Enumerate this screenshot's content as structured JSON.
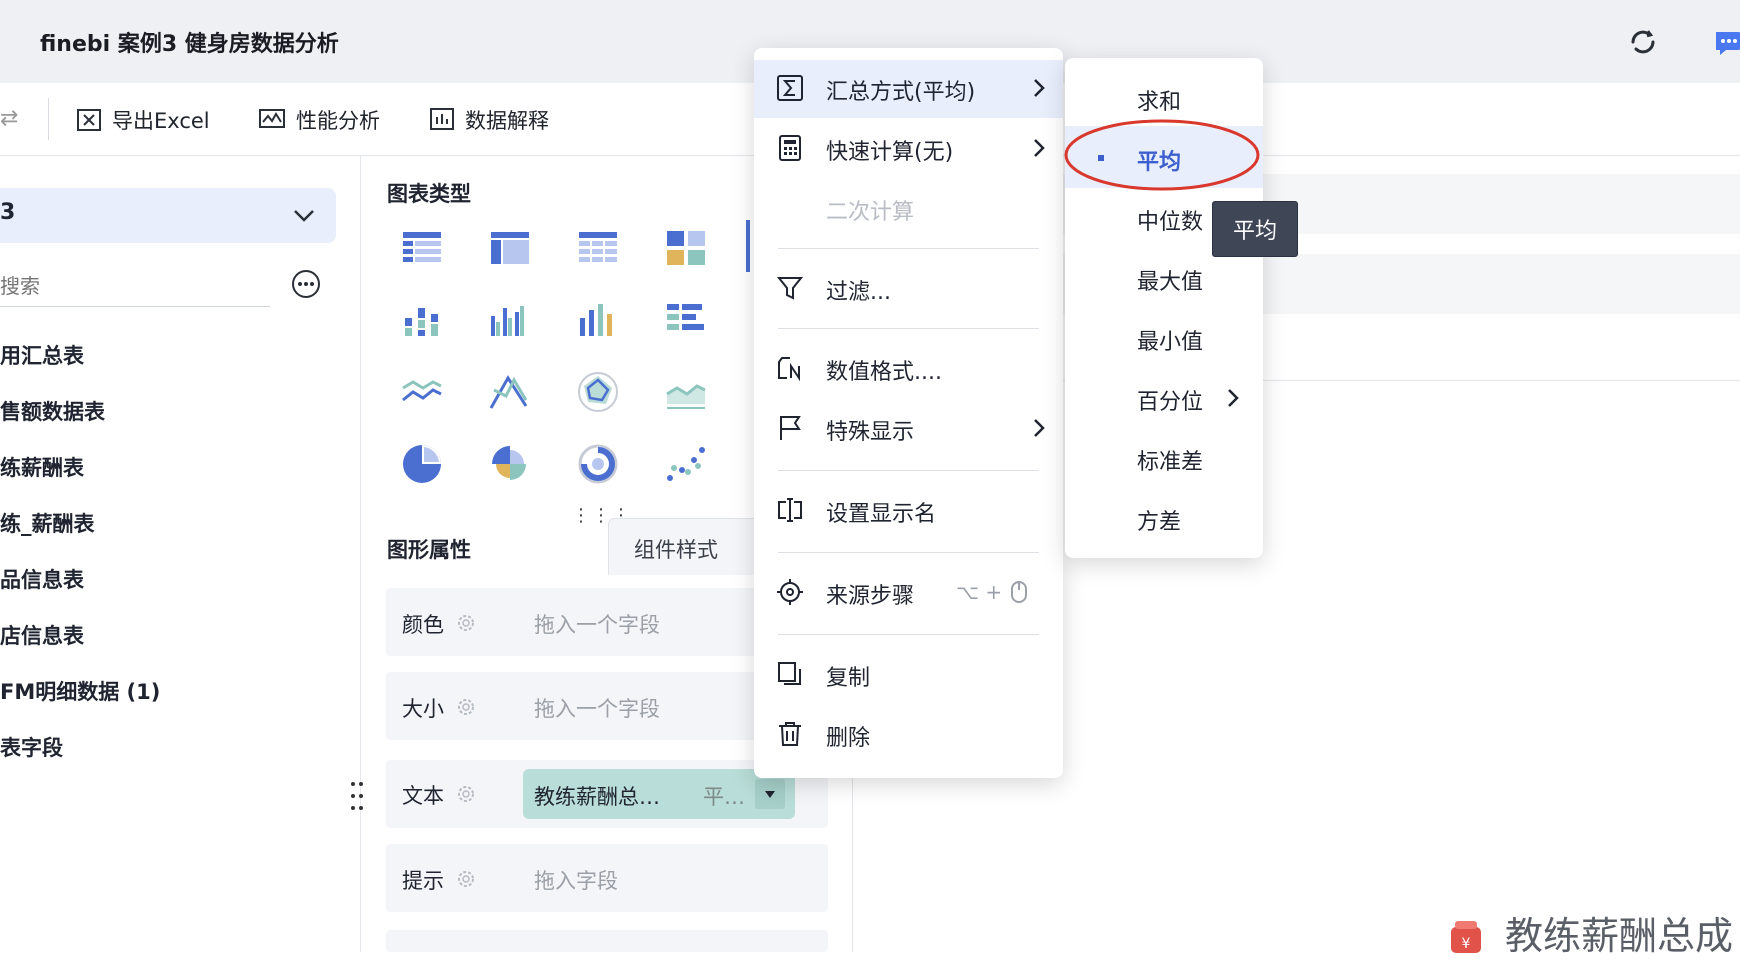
{
  "app": {
    "title": "finebi 案例3 健身房数据分析"
  },
  "toolbar": {
    "export_excel": "导出Excel",
    "performance": "性能分析",
    "data_explain": "数据解释"
  },
  "data_panel": {
    "search_placeholder": "搜索",
    "search_partial": "搜索",
    "items": [
      "用汇总表",
      "售额数据表",
      "练薪酬表",
      "练_薪酬表",
      "品信息表",
      "店信息表",
      "FM明细数据 (1)",
      "表字段"
    ]
  },
  "chart_panel": {
    "chart_type_label": "图表类型",
    "tabs": {
      "graph_props": "图形属性",
      "component_style": "组件样式"
    },
    "props": [
      {
        "label": "颜色",
        "placeholder": "拖入一个字段"
      },
      {
        "label": "大小",
        "placeholder": "拖入一个字段"
      },
      {
        "label": "文本",
        "field": "教练薪酬总…",
        "agg": "平…"
      },
      {
        "label": "提示",
        "placeholder": "拖入字段"
      }
    ]
  },
  "context_menu": {
    "items": [
      {
        "label": "汇总方式(平均)",
        "icon": "sigma-icon",
        "has_sub": true,
        "highlighted": true
      },
      {
        "label": "快速计算(无)",
        "icon": "calculator-icon",
        "has_sub": true
      },
      {
        "label": "二次计算",
        "disabled": true
      },
      {
        "label": "过滤...",
        "icon": "filter-icon"
      },
      {
        "label": "数值格式....",
        "icon": "number-format-icon"
      },
      {
        "label": "特殊显示",
        "icon": "flag-icon",
        "has_sub": true
      },
      {
        "label": "设置显示名",
        "icon": "rename-icon"
      },
      {
        "label": "来源步骤",
        "icon": "target-icon",
        "shortcut": "⌥ +"
      },
      {
        "label": "复制",
        "icon": "copy-icon"
      },
      {
        "label": "删除",
        "icon": "trash-icon"
      }
    ]
  },
  "aggregation_submenu": {
    "items": [
      "求和",
      "平均",
      "中位数",
      "最大值",
      "最小值",
      "百分位",
      "标准差",
      "方差"
    ],
    "selected": "平均"
  },
  "tooltip": {
    "text": "平均"
  },
  "canvas": {
    "bottom_title": "教练薪酬总成"
  },
  "colors": {
    "accent": "#3d5ecf",
    "highlight_bg": "#e8eefc",
    "annotation": "#d9382c",
    "pill": "#b9ddd8"
  }
}
